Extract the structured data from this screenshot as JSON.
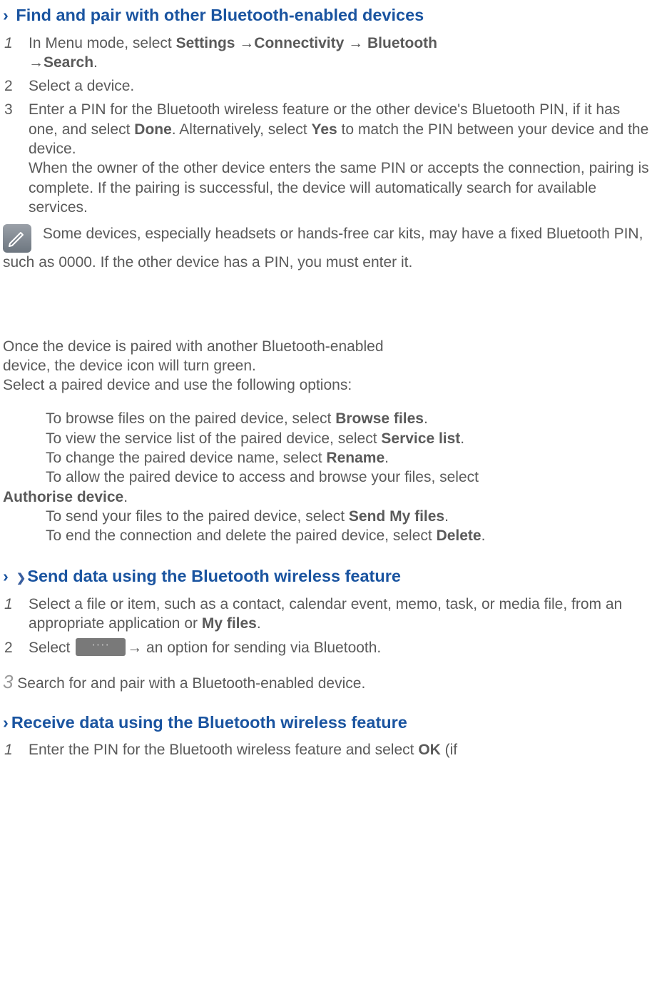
{
  "section1": {
    "caret": "›",
    "title": "Find and pair with other Bluetooth-enabled devices",
    "step1": {
      "num": "1",
      "pre": "In Menu mode, select ",
      "b1": "Settings ",
      "arr1": "→",
      "b2": "Connectivity ",
      "arr2": "→ ",
      "b3": "Bluetooth ",
      "arr3": "→",
      "b4": "Search",
      "post": "."
    },
    "step2": {
      "num": "2",
      "text": "Select a device."
    },
    "step3": {
      "num": "3",
      "line_a_pre": "Enter a PIN for the Bluetooth wireless feature or the other device's Bluetooth PIN, if it has one, and select ",
      "b_done": "Done",
      "line_a_mid": ". Alternatively, select ",
      "b_yes": "Yes",
      "line_a_post": " to match the PIN between your device and the device.",
      "line_b": "When the owner of the other device enters the same PIN or accepts the connection, pairing is complete. If the pairing is successful, the device will automatically search for available services."
    },
    "note": "Some devices, especially headsets or hands-free car kits, may have a fixed Bluetooth PIN, such as 0000. If the other device has a PIN, you must enter it."
  },
  "mid": {
    "p1a": "Once the device is paired with another Bluetooth-enabled",
    "p1b": "device, the device icon will turn green.",
    "p2": "Select a paired device and use the following options:"
  },
  "options": {
    "o1_pre": "To browse files on the paired device, select ",
    "o1_b": "Browse files",
    "o2_pre": "To view the service list of the paired device, select ",
    "o2_b": "Service list",
    "o3_pre": "To change the paired device name, select ",
    "o3_b": "Rename",
    "o4_pre": "To allow the paired device to access and browse your files, select ",
    "o4_b": "Authorise device",
    "o5_pre": "To send your files to the paired device, select ",
    "o5_b": "Send My files",
    "o6_pre": "To end the connection and delete the paired device, select ",
    "o6_b": "Delete",
    "period": "."
  },
  "section2": {
    "caret": "›",
    "glyph": "❯",
    "title": "Send data using the Bluetooth wireless feature",
    "step1": {
      "num": "1",
      "pre": "Select a file or item, such as a contact, calendar event, memo, task, or media file, from an appropriate application or ",
      "b": "My files",
      "post": "."
    },
    "step2": {
      "num": "2",
      "pre": "Select ",
      "post": "→ an option for sending via Bluetooth."
    },
    "step3": {
      "num": "3",
      "text": " Search for and pair with a Bluetooth-enabled device."
    }
  },
  "section3": {
    "caret": "›",
    "title": "Receive data using the Bluetooth wireless feature",
    "step1": {
      "num": "1",
      "pre": "Enter the PIN for the Bluetooth wireless feature and select ",
      "b": "OK",
      "post": " (if"
    }
  }
}
